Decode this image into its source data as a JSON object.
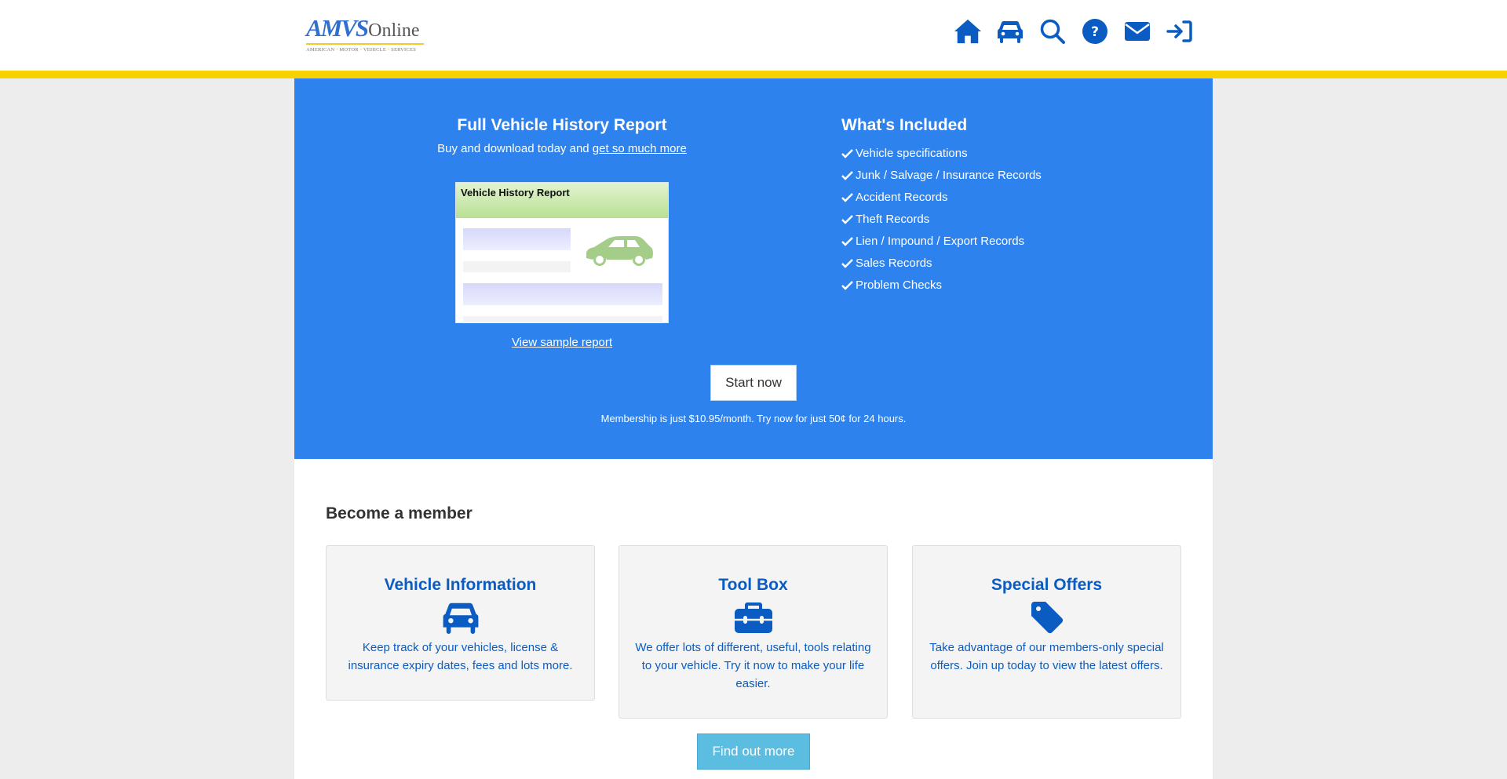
{
  "header": {
    "logo": {
      "brand": "AMVS",
      "suffix": "Online",
      "tagline_parts": [
        "AMERICAN",
        "MOTOR",
        "VEHICLE",
        "SERVICES"
      ]
    },
    "nav_icons": [
      "home-icon",
      "car-icon",
      "search-icon",
      "help-icon",
      "envelope-icon",
      "sign-in-icon"
    ],
    "accent_bar_color": "#f7d100"
  },
  "hero": {
    "background_color": "#2e82ee",
    "title": "Full Vehicle History Report",
    "subtitle_prefix": "Buy and download today and ",
    "subtitle_link": "get so much more",
    "thumbnail_title": "Vehicle History Report",
    "view_sample_link": "View sample report",
    "included_title": "What's Included",
    "included_items": [
      "Vehicle specifications",
      "Junk / Salvage / Insurance Records",
      "Accident Records",
      "Theft Records",
      "Lien / Impound / Export Records",
      "Sales Records",
      "Problem Checks"
    ],
    "start_button": "Start now",
    "membership_note": "Membership is just $10.95/month. Try now for just 50¢ for 24 hours."
  },
  "member": {
    "title": "Become a member",
    "cards": [
      {
        "title": "Vehicle Information",
        "icon": "car-icon",
        "description": "Keep track of your vehicles, license & insurance expiry dates, fees and lots more."
      },
      {
        "title": "Tool Box",
        "icon": "toolbox-icon",
        "description": "We offer lots of different, useful, tools relating to your vehicle. Try it now to make your life easier."
      },
      {
        "title": "Special Offers",
        "icon": "tag-icon",
        "description": "Take advantage of our members-only special offers. Join up today to view the latest offers."
      }
    ],
    "find_out_button": "Find out more"
  }
}
